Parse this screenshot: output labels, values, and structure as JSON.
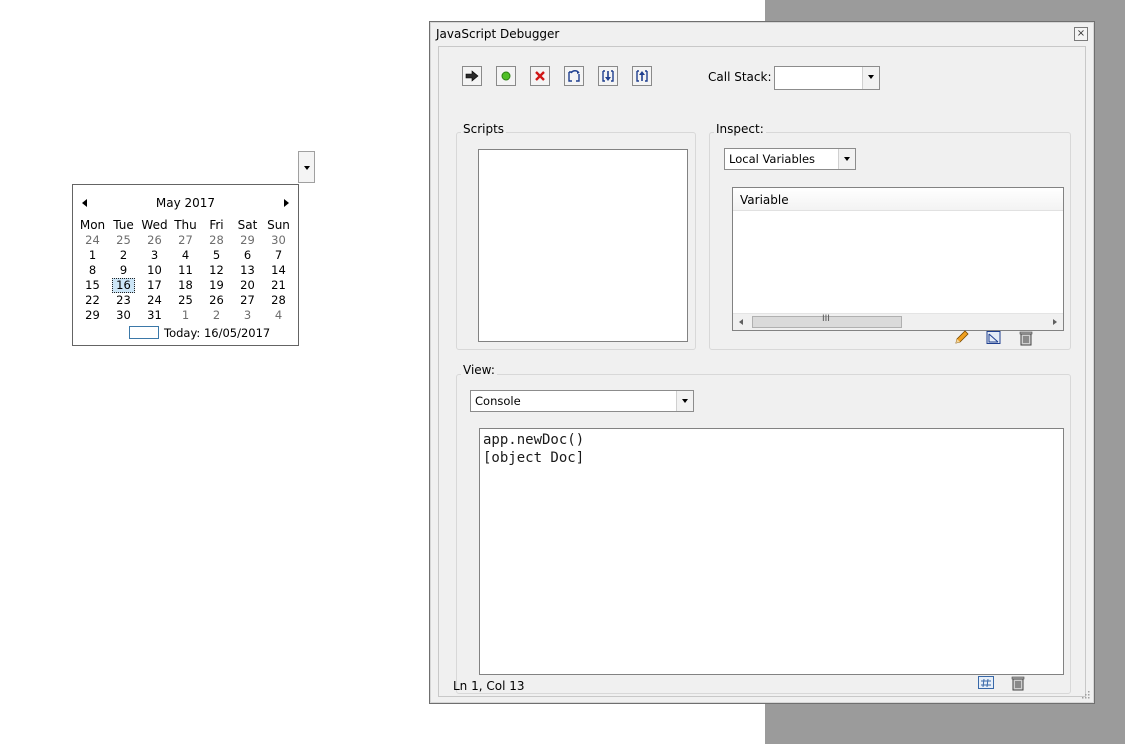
{
  "datepicker": {
    "month_title": "May 2017",
    "weekdays": [
      "Mon",
      "Tue",
      "Wed",
      "Thu",
      "Fri",
      "Sat",
      "Sun"
    ],
    "weeks": [
      [
        "24",
        "25",
        "26",
        "27",
        "28",
        "29",
        "30"
      ],
      [
        "1",
        "2",
        "3",
        "4",
        "5",
        "6",
        "7"
      ],
      [
        "8",
        "9",
        "10",
        "11",
        "12",
        "13",
        "14"
      ],
      [
        "15",
        "16",
        "17",
        "18",
        "19",
        "20",
        "21"
      ],
      [
        "22",
        "23",
        "24",
        "25",
        "26",
        "27",
        "28"
      ],
      [
        "29",
        "30",
        "31",
        "1",
        "2",
        "3",
        "4"
      ]
    ],
    "selected_day": "16",
    "today_label": "Today: 16/05/2017"
  },
  "debugger": {
    "window_title": "JavaScript Debugger",
    "close_glyph": "×",
    "toolbar": {
      "buttons": [
        "resume-icon",
        "run-icon",
        "stop-icon",
        "step-over-icon",
        "step-into-icon",
        "step-out-icon"
      ],
      "call_stack_label": "Call Stack:",
      "call_stack_value": ""
    },
    "scripts": {
      "label": "Scripts"
    },
    "inspect": {
      "label": "Inspect:",
      "dropdown_value": "Local Variables",
      "column_header": "Variable",
      "scroll_thumb_glyph": "III",
      "buttons": [
        "edit-icon",
        "watch-icon",
        "delete-icon"
      ]
    },
    "view": {
      "label": "View:",
      "dropdown_value": "Console",
      "console_text": "app.newDoc()\n[object Doc]",
      "buttons": [
        "line-numbers-icon",
        "clear-icon"
      ]
    },
    "status_text": "Ln 1, Col 13"
  },
  "colors": {
    "window_bg": "#f0f0f0",
    "desktop_grey": "#9b9b9b",
    "selected_day_bg": "#cde6f7"
  }
}
